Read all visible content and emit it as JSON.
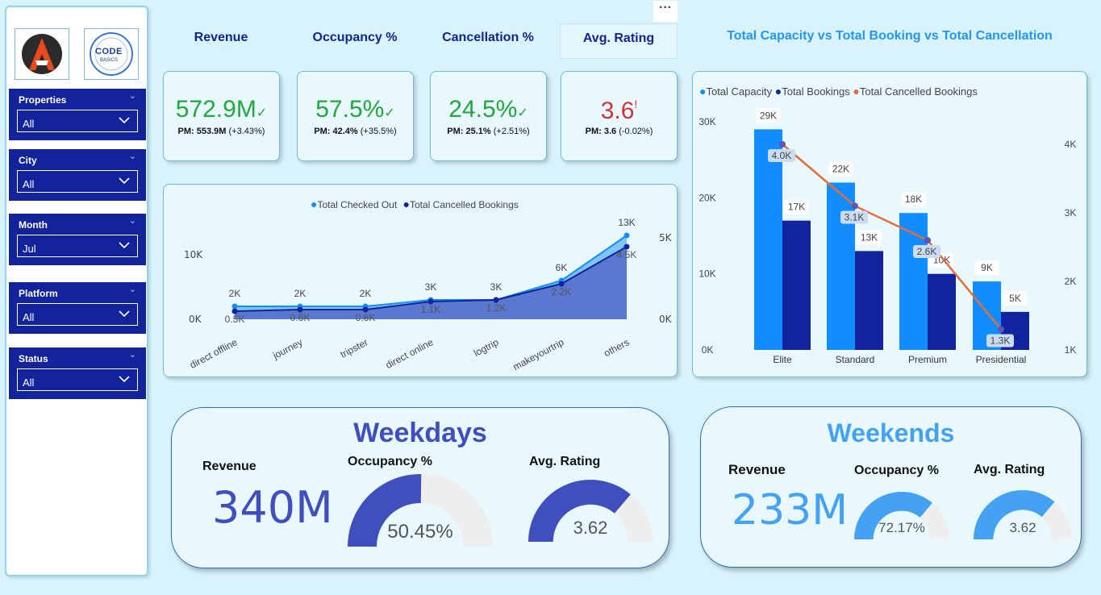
{
  "sidebar": {
    "logos": [
      {
        "name": "atliq-logo",
        "text": "A"
      },
      {
        "name": "codebasics-logo",
        "text": "CODE",
        "sub": "BASICS"
      }
    ],
    "slicers": [
      {
        "title": "Properties",
        "value": "All"
      },
      {
        "title": "City",
        "value": "All"
      },
      {
        "title": "Month",
        "value": "Jul"
      },
      {
        "title": "Platform",
        "value": "All"
      },
      {
        "title": "Status",
        "value": "All"
      }
    ]
  },
  "more_options": "···",
  "kpis": [
    {
      "title": "Revenue",
      "value": "572.9M",
      "trend": "✓",
      "pm": "PM: 553.9M",
      "change": "(+3.43%)",
      "color": "#1fa83c"
    },
    {
      "title": "Occupancy %",
      "value": "57.5%",
      "trend": "✓",
      "pm": "PM: 42.4%",
      "change": "(+35.5%)",
      "color": "#1fa83c"
    },
    {
      "title": "Cancellation %",
      "value": "24.5%",
      "trend": "✓",
      "pm": "PM: 25.1%",
      "change": "(+2.51%)",
      "color": "#1fa83c"
    },
    {
      "title": "Avg. Rating",
      "value": "3.6",
      "trend": "!",
      "pm": "PM: 3.6",
      "change": "(-0.02%)",
      "color": "#d13438"
    }
  ],
  "chart_data": [
    {
      "type": "area",
      "legend": [
        "Total Checked Out",
        "Total Cancelled Bookings"
      ],
      "categories": [
        "direct offline",
        "journey",
        "tripster",
        "direct online",
        "logtrip",
        "makeyourtrip",
        "others"
      ],
      "series": [
        {
          "name": "Total Checked Out",
          "values": [
            2000,
            2000,
            2000,
            3000,
            3000,
            6000,
            13000
          ],
          "labels": [
            "2K",
            "2K",
            "2K",
            "3K",
            "3K",
            "6K",
            "13K"
          ]
        },
        {
          "name": "Total Cancelled Bookings",
          "values": [
            500,
            600,
            600,
            1100,
            1200,
            2200,
            4500
          ],
          "labels": [
            "0.5K",
            "0.6K",
            "0.6K",
            "1.1K",
            "1.2K",
            "2.2K",
            "4.5K"
          ]
        }
      ],
      "y_left_ticks": [
        "0K",
        "10K"
      ],
      "y_right_ticks": [
        "0K",
        "5K"
      ],
      "legend_position": "top"
    },
    {
      "type": "bar",
      "title": "Total Capacity vs Total Booking vs Total Cancellation",
      "legend": [
        "Total Capacity",
        "Total Bookings",
        "Total Cancelled Bookings"
      ],
      "categories": [
        "Elite",
        "Standard",
        "Premium",
        "Presidential"
      ],
      "series": [
        {
          "name": "Total Capacity",
          "values": [
            29000,
            22000,
            18000,
            9000
          ],
          "labels": [
            "29K",
            "22K",
            "18K",
            "9K"
          ],
          "color": "#118dff"
        },
        {
          "name": "Total Bookings",
          "values": [
            17000,
            13000,
            10000,
            5000
          ],
          "labels": [
            "17K",
            "13K",
            "10K",
            "5K"
          ],
          "color": "#12239e"
        },
        {
          "name": "Total Cancelled Bookings",
          "type": "line",
          "values": [
            4000,
            3100,
            2600,
            1300
          ],
          "labels": [
            "4.0K",
            "3.1K",
            "2.6K",
            "1.3K"
          ],
          "color": "#e66c37"
        }
      ],
      "y_left_ticks": [
        "0K",
        "10K",
        "20K",
        "30K"
      ],
      "y_right_ticks": [
        "1K",
        "2K",
        "3K",
        "4K"
      ],
      "ylim_left": [
        0,
        30000
      ],
      "ylim_right": [
        1000,
        4000
      ],
      "legend_position": "top-left"
    }
  ],
  "weekdays": {
    "title": "Weekdays",
    "revenue_label": "Revenue",
    "revenue": "340M",
    "occupancy_label": "Occupancy %",
    "occupancy": "50.45%",
    "occupancy_frac": 0.5045,
    "rating_label": "Avg. Rating",
    "rating": "3.62",
    "rating_frac": 0.724,
    "color": "#3f4fbd",
    "gauge_color": "#3f4fbd"
  },
  "weekends": {
    "title": "Weekends",
    "revenue_label": "Revenue",
    "revenue": "233M",
    "occupancy_label": "Occupancy %",
    "occupancy": "72.17%",
    "occupancy_frac": 0.7217,
    "rating_label": "Avg. Rating",
    "rating": "3.62",
    "rating_frac": 0.724,
    "color": "#45a2f3",
    "gauge_color": "#45a2f3"
  }
}
